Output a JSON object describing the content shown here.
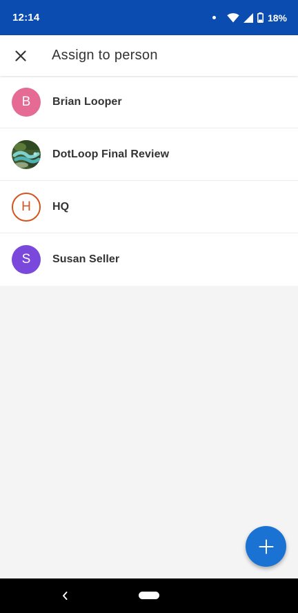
{
  "status_bar": {
    "time": "12:14",
    "battery": "18%",
    "icons": [
      "notification-dot",
      "wifi-icon",
      "cell-signal-icon",
      "battery-icon"
    ]
  },
  "header": {
    "close_icon": "close-icon",
    "title": "Assign to person"
  },
  "people": [
    {
      "name": "Brian Looper",
      "initial": "B",
      "avatar_color": "#e56a94",
      "avatar_style": "filled"
    },
    {
      "name": "DotLoop Final Review",
      "initial": "",
      "avatar_style": "photo"
    },
    {
      "name": "HQ",
      "initial": "H",
      "avatar_color": "#d4521c",
      "avatar_style": "outline"
    },
    {
      "name": "Susan Seller",
      "initial": "S",
      "avatar_color": "#7b48dc",
      "avatar_style": "filled"
    }
  ],
  "fab": {
    "icon": "plus-icon",
    "color": "#1a73d3"
  },
  "nav_bar": {
    "back_icon": "back-chevron-icon",
    "home_icon": "home-pill-icon"
  },
  "colors": {
    "status_bar": "#0a4cb0",
    "background": "#f4f4f4"
  }
}
